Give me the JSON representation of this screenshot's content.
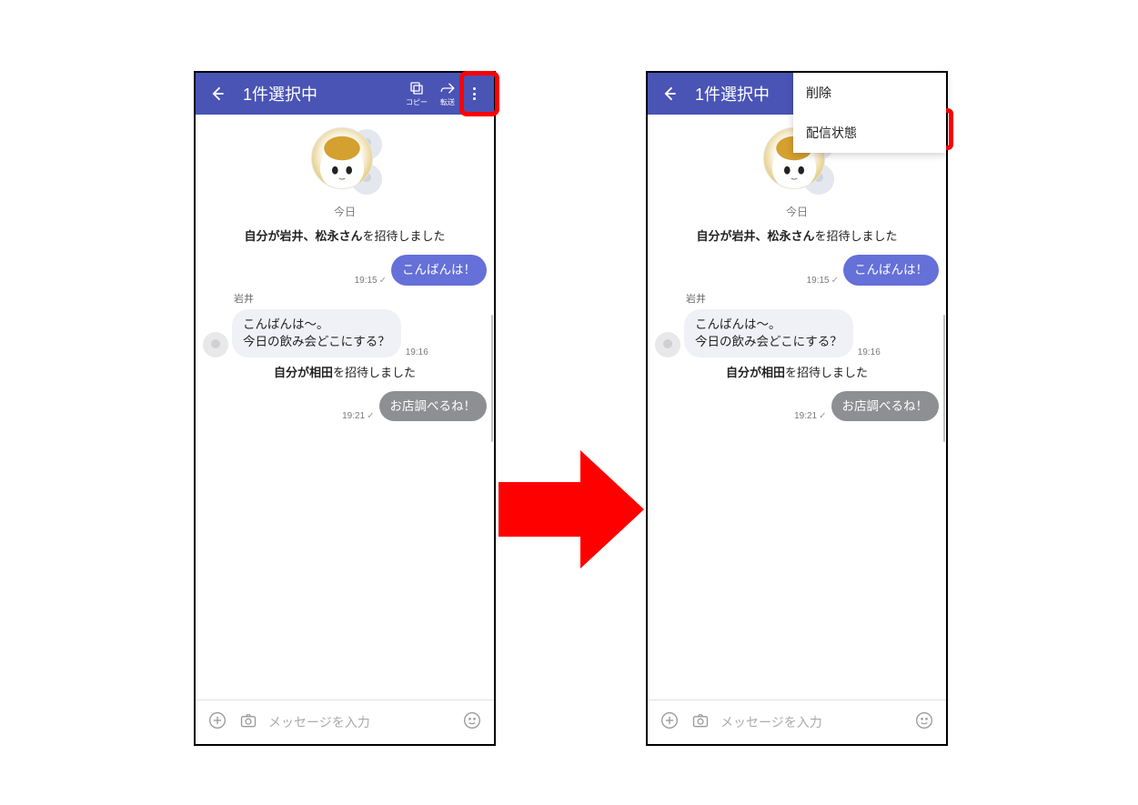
{
  "header": {
    "title": "1件選択中",
    "copy_label": "コピー",
    "forward_label": "転送"
  },
  "dropdown": {
    "delete": "削除",
    "delivery_status": "配信状態"
  },
  "chat": {
    "date": "今日",
    "invite1_prefix": "自分が岩井、松永さん",
    "invite1_suffix": "を招待しました",
    "msg1_text": "こんばんは！",
    "msg1_time": "19:15",
    "sender_iwai": "岩井",
    "msg2_line1": "こんばんは〜。",
    "msg2_line2": "今日の飲み会どこにする？",
    "msg2_time": "19:16",
    "invite2_prefix": "自分が相田",
    "invite2_suffix": "を招待しました",
    "msg3_text": "お店調べるね！",
    "msg3_time": "19:21"
  },
  "input": {
    "placeholder": "メッセージを入力"
  }
}
